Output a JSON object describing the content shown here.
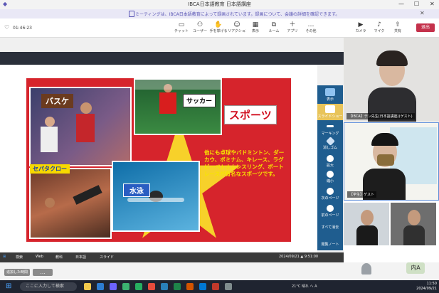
{
  "window": {
    "title": "IBCA日本語教育 日本語講座",
    "minimize": "—",
    "maximize": "☐",
    "close": "✕"
  },
  "notice": {
    "text": "ミーティングは、IBCA日本語教育によって録画されています。録画について、会議の詳細を確認できます。",
    "close": "✕"
  },
  "meeting": {
    "elapsed": "01:46:23"
  },
  "toolbar": {
    "items": [
      {
        "icon": "chat",
        "label": "チャット"
      },
      {
        "icon": "people",
        "label": "ユーザー"
      },
      {
        "icon": "raise",
        "label": "手を挙げる"
      },
      {
        "icon": "react",
        "label": "リアクション"
      },
      {
        "icon": "view",
        "label": "表示"
      },
      {
        "icon": "rooms",
        "label": "ルーム"
      },
      {
        "icon": "apps",
        "label": "アプリ"
      },
      {
        "icon": "more",
        "label": "その他"
      },
      {
        "icon": "camera",
        "label": "カメラ"
      },
      {
        "icon": "mic",
        "label": "マイク"
      },
      {
        "icon": "share",
        "label": "共有"
      }
    ],
    "leave": "退出"
  },
  "slide": {
    "label_basketball": "バスケ",
    "label_soccer": "サッカー",
    "label_sports": "スポーツ",
    "label_sepaktakraw": "セパタクロー",
    "label_swimming": "水泳",
    "body_text": "他にも卓球やバドミントン、ダーカウ、ボミナム、キレース、ラグビーベトナムレスリング、ボートレースが有名なスポーツです。"
  },
  "side_panel": [
    {
      "label": "表示"
    },
    {
      "label": "スライドショー"
    },
    {
      "label": "マーキング"
    },
    {
      "label": "消しゴム"
    },
    {
      "label": "拡大"
    },
    {
      "label": "縮小"
    },
    {
      "label": "次のページ"
    },
    {
      "label": "前のページ"
    },
    {
      "label": "すべて消去"
    },
    {
      "label": "閲覧ノート"
    }
  ],
  "participants": [
    {
      "name": "【IBCA】テン先生(日本語講座)(ゲスト)"
    },
    {
      "name": "【学生】ゲスト"
    },
    {
      "name": ""
    },
    {
      "name": ""
    }
  ],
  "share_taskbar": {
    "items": [
      "検索",
      "Web",
      "教科",
      "日本語",
      "スライド"
    ],
    "clock": "2024/09/21 ▲ 9:51:00"
  },
  "bottom": {
    "btn1": "追加した時間",
    "btn2": "…",
    "avatar": "内A"
  },
  "windows": {
    "search_placeholder": "ここに入力して検索",
    "tray": "21°C 晴れ  へ  A",
    "time": "11:50",
    "date": "2024/09/21"
  }
}
